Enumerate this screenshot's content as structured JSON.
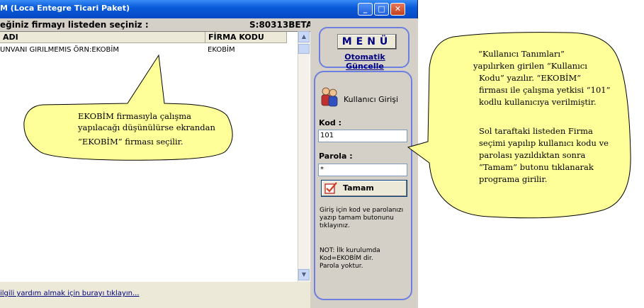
{
  "window": {
    "title": "M (Loca Entegre Ticari Paket)",
    "minimize_glyph": "_",
    "maximize_glyph": "□",
    "close_glyph": "✕"
  },
  "company_list": {
    "header": "eğiniz firmayı listeden seçiniz :",
    "version": "S:80313BETA",
    "columns": {
      "name": "ADI",
      "code": "FİRMA KODU"
    },
    "rows": [
      {
        "name": "UNVANI GIRILMEMIS ÖRN:EKOBİM",
        "code": "EKOBİM"
      }
    ],
    "scroll_up": "▲",
    "scroll_down": "▼",
    "help_link": "ilgili yardım almak için burayı tıklayın..."
  },
  "menu": {
    "button_label": "MENÜ",
    "auto_update_link": "Otomatik Güncelle"
  },
  "login": {
    "title": "Kullanıcı Girişi",
    "code_label": "Kod   :",
    "code_value": "101",
    "password_label": "Parola :",
    "password_value": "*",
    "ok_button": "Tamam",
    "info": "Giriş için kod ve parolanızı yazıp tamam butonunu tıklayınız.",
    "note_line1": "NOT: İlk kurulumda",
    "note_line2": "Kod=EKOBİM dir.",
    "note_line3": "Parola yoktur."
  },
  "callouts": {
    "left": {
      "line1": "EKOBİM firmasıyla çalışma",
      "line2": "yapılacağı düşünülürse ekrandan",
      "line3": "“EKOBİM” firması seçilir."
    },
    "right": {
      "line1": "“Kullanıcı Tanımları”",
      "line2": "yapılırken girilen “Kullanıcı",
      "line3": "Kodu” yazılır. “EKOBİM”",
      "line4": "firması ile çalışma yetkisi “101”",
      "line5": "kodlu kullanıcıya verilmiştir.",
      "line6": "Sol taraftaki listeden Firma",
      "line7": "seçimi yapılıp kullanıcı kodu ve",
      "line8": "parolası yazıldıktan sonra",
      "line9": "“Tamam” butonu tıklanarak",
      "line10": "programa girilir."
    }
  },
  "colors": {
    "titlebar": "#0a5bd9",
    "callout_fill": "#ffff99",
    "panel_border": "#6c7fe0"
  }
}
